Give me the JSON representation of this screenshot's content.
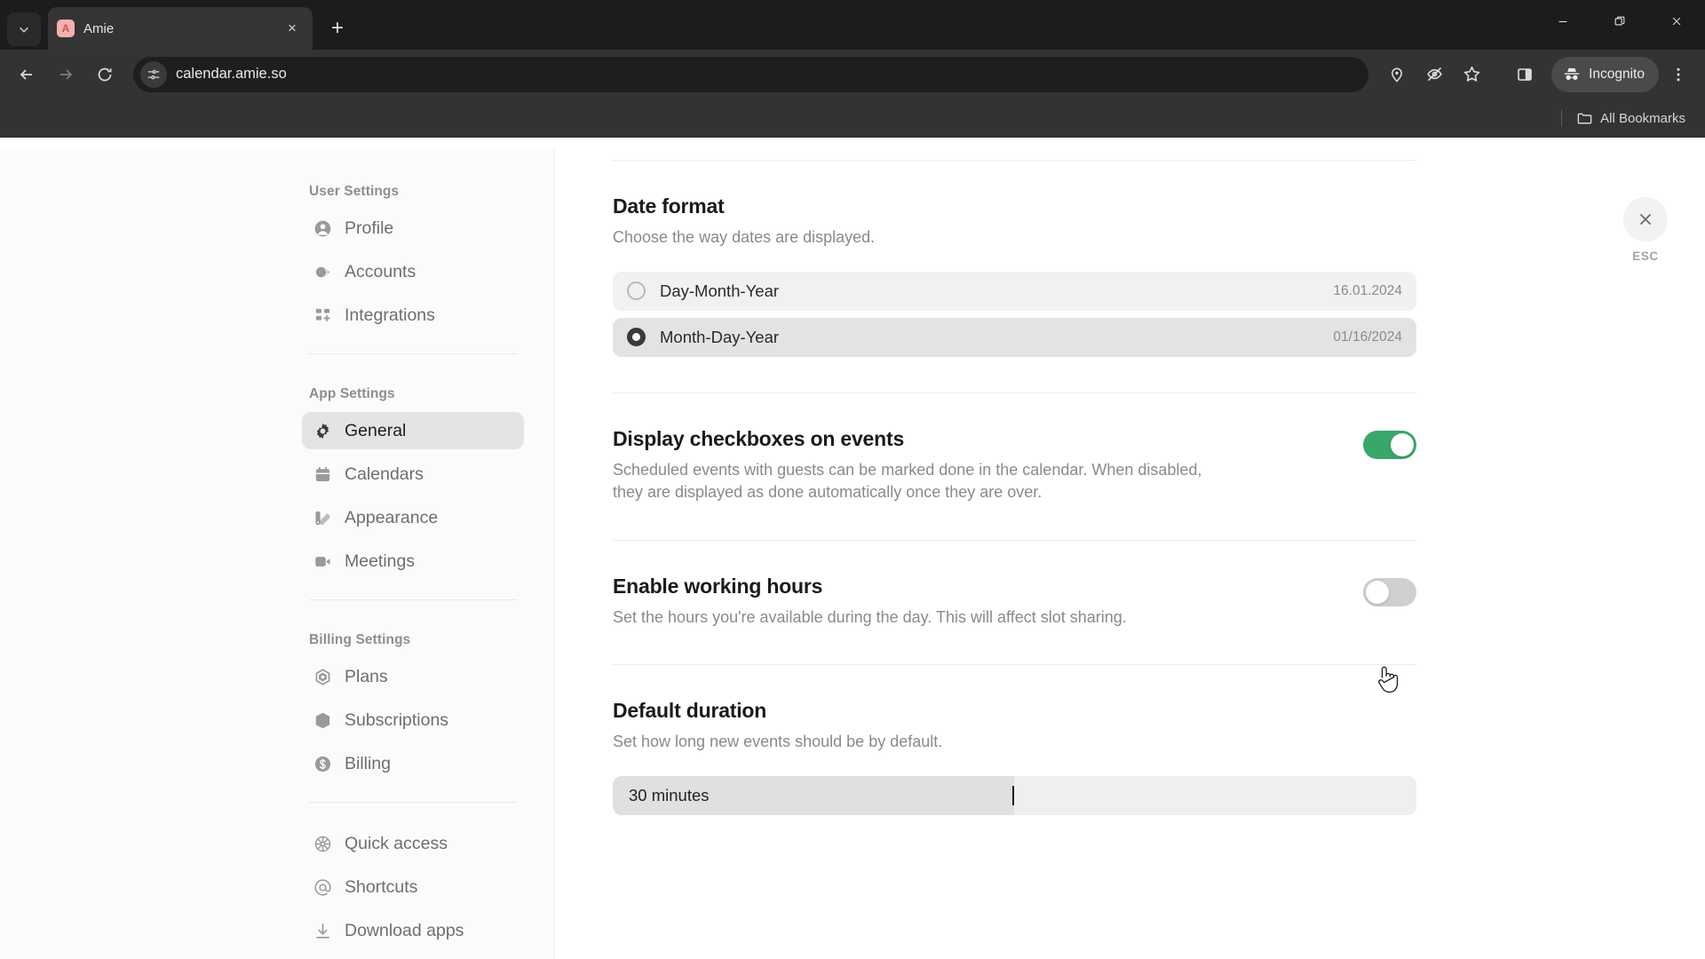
{
  "browser": {
    "tab": {
      "title": "Amie",
      "favicon_letter": "A",
      "favicon_color": "#f6b0ae"
    },
    "tab_list_icon": "chevron-down-icon",
    "new_tab_label": "+",
    "close_tab_label": "×",
    "window_controls": {
      "minimize": "—",
      "maximize": "❐",
      "close": "✕"
    },
    "nav": {
      "back": "←",
      "forward": "→",
      "reload": "⟳"
    },
    "omnibox": {
      "url": "calendar.amie.so",
      "site_info_icon": "site-settings-icon"
    },
    "toolbar_icons": [
      "location-pin-icon",
      "eye-off-icon",
      "star-icon",
      "side-panel-icon"
    ],
    "incognito": {
      "label": "Incognito",
      "icon": "incognito-icon"
    },
    "bookmarks": {
      "all_bookmarks_label": "All Bookmarks",
      "folder_icon": "folder-icon"
    }
  },
  "sidebar": {
    "groups": [
      {
        "label": "User Settings",
        "items": [
          {
            "label": "Profile",
            "icon": "user-circle-icon",
            "active": false
          },
          {
            "label": "Accounts",
            "icon": "accounts-icon",
            "active": false
          },
          {
            "label": "Integrations",
            "icon": "grid-plus-icon",
            "active": false
          }
        ]
      },
      {
        "label": "App Settings",
        "items": [
          {
            "label": "General",
            "icon": "gear-icon",
            "active": true
          },
          {
            "label": "Calendars",
            "icon": "calendar-icon",
            "active": false
          },
          {
            "label": "Appearance",
            "icon": "appearance-icon",
            "active": false
          },
          {
            "label": "Meetings",
            "icon": "video-camera-icon",
            "active": false
          }
        ]
      },
      {
        "label": "Billing Settings",
        "items": [
          {
            "label": "Plans",
            "icon": "hexagon-icon",
            "active": false
          },
          {
            "label": "Subscriptions",
            "icon": "box-icon",
            "active": false
          },
          {
            "label": "Billing",
            "icon": "dollar-circle-icon",
            "active": false
          }
        ]
      },
      {
        "label": "",
        "items": [
          {
            "label": "Quick access",
            "icon": "wheel-icon",
            "active": false
          },
          {
            "label": "Shortcuts",
            "icon": "at-icon",
            "active": false
          },
          {
            "label": "Download apps",
            "icon": "download-icon",
            "active": false
          }
        ]
      }
    ]
  },
  "main": {
    "esc": {
      "label": "ESC",
      "icon": "close-icon"
    },
    "date_format": {
      "title": "Date format",
      "description": "Choose the way dates are displayed.",
      "options": [
        {
          "label": "Day-Month-Year",
          "example": "16.01.2024",
          "selected": false
        },
        {
          "label": "Month-Day-Year",
          "example": "01/16/2024",
          "selected": true
        }
      ]
    },
    "checkboxes": {
      "title": "Display checkboxes on events",
      "description": "Scheduled events with guests can be marked done in the calendar. When disabled, they are displayed as done automatically once they are over.",
      "enabled": true,
      "on_color": "#3aa76a"
    },
    "working_hours": {
      "title": "Enable working hours",
      "description": "Set the hours you're available during the day. This will affect slot sharing.",
      "enabled": false,
      "off_color": "#cfcfcf"
    },
    "default_duration": {
      "title": "Default duration",
      "description": "Set how long new events should be by default.",
      "value": "30 minutes"
    }
  }
}
